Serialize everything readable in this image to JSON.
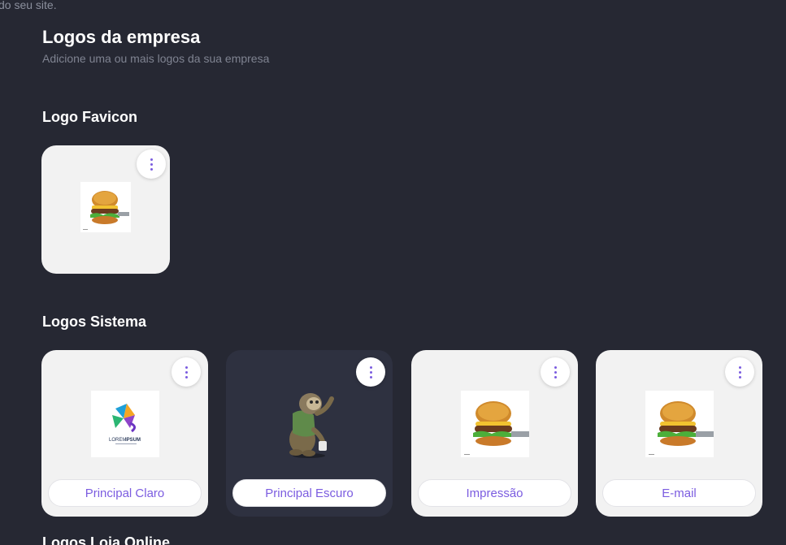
{
  "top_snippet": "do seu site.",
  "header": {
    "title": "Logos da empresa",
    "subtitle": "Adicione uma ou mais logos da sua empresa"
  },
  "favicon_section": {
    "title": "Logo Favicon"
  },
  "system_section": {
    "title": "Logos Sistema",
    "cards": [
      {
        "label": "Principal Claro"
      },
      {
        "label": "Principal Escuro"
      },
      {
        "label": "Impressão"
      },
      {
        "label": "E-mail"
      }
    ]
  },
  "next_section": {
    "title": "Logos Loja Online"
  },
  "lorem_logo": {
    "text_light": "LOREM",
    "text_bold": "IPSUM"
  },
  "colors": {
    "background": "#262833",
    "card_light": "#f2f2f2",
    "card_dark": "#2e3140",
    "accent": "#7b5ce0"
  },
  "icons": {
    "menu": "vertical-ellipsis-icon"
  }
}
